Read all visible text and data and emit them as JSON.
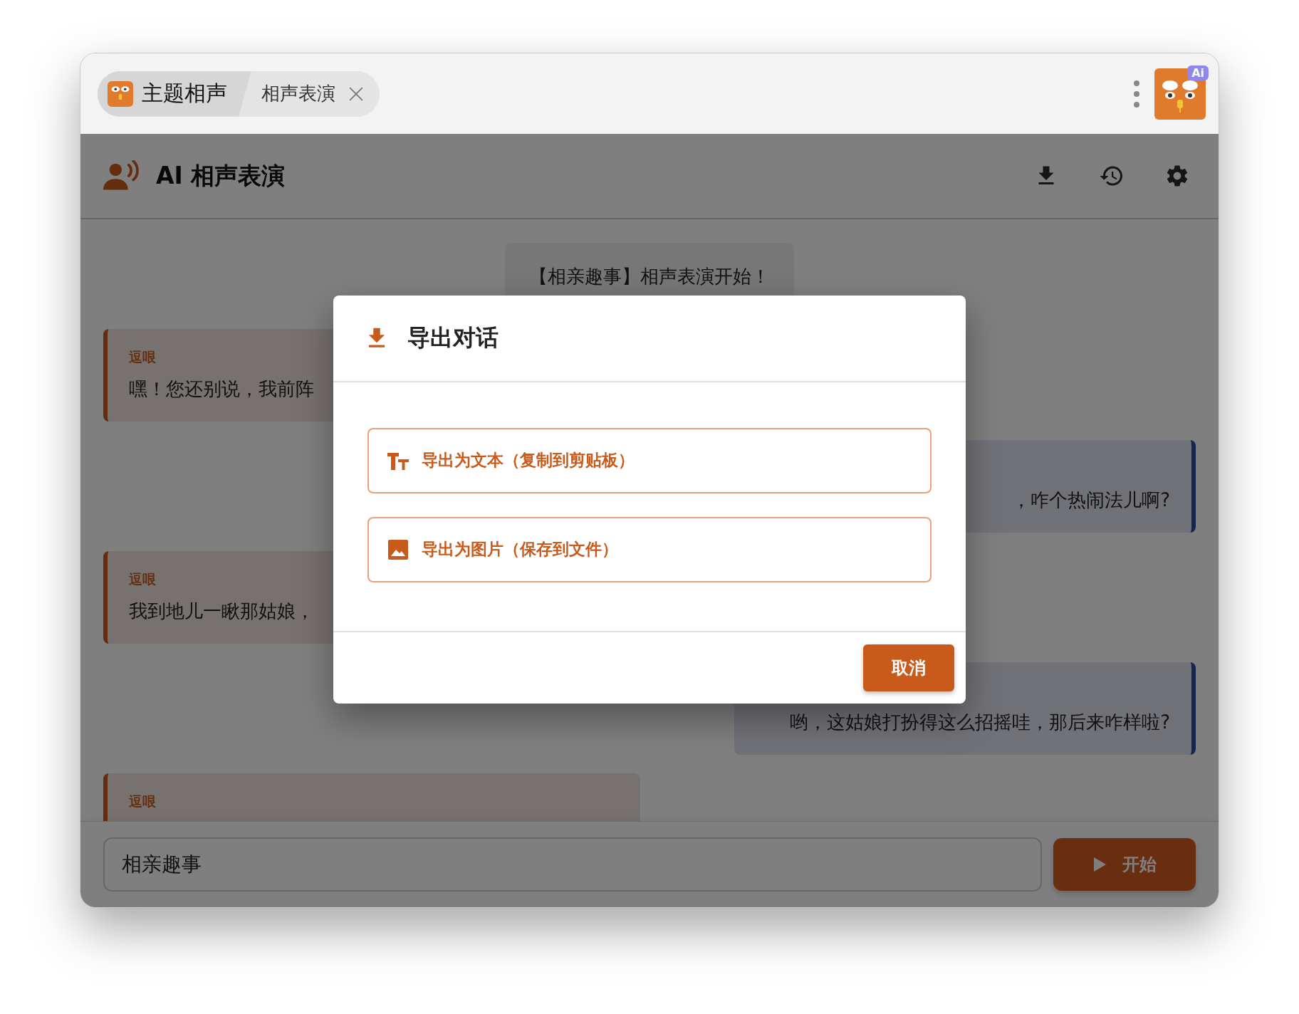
{
  "tabs": [
    {
      "kind": "home",
      "label": "主题相声",
      "selected": true
    },
    {
      "kind": "page",
      "label": "相声表演",
      "selected": false
    }
  ],
  "app_badge": "Ai",
  "header": {
    "title": "AI 相声表演"
  },
  "messages": [
    {
      "kind": "system",
      "text": "【相亲趣事】相声表演开始！"
    },
    {
      "kind": "left",
      "speaker": "逗哏",
      "text": "嘿！您还别说，我前阵"
    },
    {
      "kind": "right",
      "text": "，咋个热闹法儿啊?"
    },
    {
      "kind": "left",
      "speaker": "逗哏",
      "text": "我到地儿一瞅那姑娘，"
    },
    {
      "kind": "right",
      "text": "哟，这姑娘打扮得这么招摇哇，那后来咋样啦?"
    },
    {
      "kind": "left",
      "speaker": "逗哏"
    }
  ],
  "dialog": {
    "title": "导出对话",
    "options": [
      {
        "kind": "text",
        "label": "导出为文本（复制到剪贴板）"
      },
      {
        "kind": "image",
        "label": "导出为图片（保存到文件）"
      }
    ],
    "cancel": "取消"
  },
  "input": {
    "value": "相亲趣事"
  },
  "start_button": "开始"
}
